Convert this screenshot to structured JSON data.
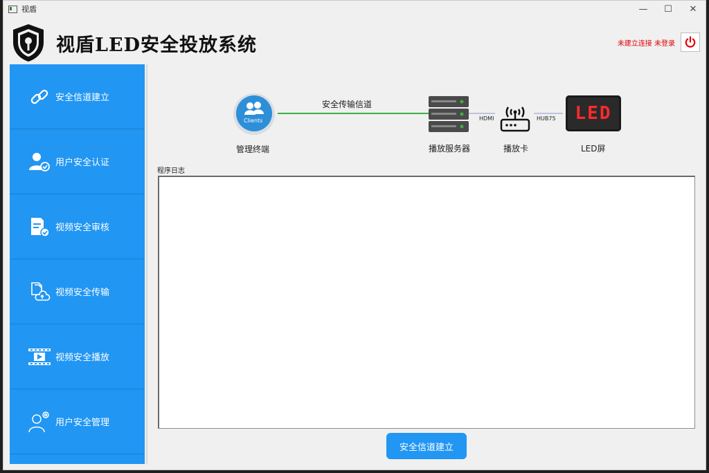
{
  "window": {
    "title": "视盾"
  },
  "header": {
    "app_title": "视盾LED安全投放系统",
    "status_text": "未建立连接 未登录"
  },
  "sidebar": {
    "items": [
      {
        "label": "安全信道建立",
        "icon": "link-icon"
      },
      {
        "label": "用户安全认证",
        "icon": "user-verified-icon"
      },
      {
        "label": "视频安全审核",
        "icon": "document-check-icon"
      },
      {
        "label": "视频安全传输",
        "icon": "file-upload-cloud-icon"
      },
      {
        "label": "视频安全播放",
        "icon": "video-play-icon"
      },
      {
        "label": "用户安全管理",
        "icon": "user-settings-icon"
      }
    ]
  },
  "diagram": {
    "client_icon_text": "Clients",
    "client_label": "管理终端",
    "channel_label": "安全传输信道",
    "server_label": "播放服务器",
    "hdmi_label": "HDMI",
    "card_label": "播放卡",
    "hub_label": "HUB75",
    "led_text": "LED",
    "led_label": "LED屏"
  },
  "log": {
    "label": "程序日志",
    "content": ""
  },
  "actions": {
    "primary_button": "安全信道建立"
  },
  "colors": {
    "accent": "#2196f3",
    "status": "#e00000",
    "channel_line": "#3cb043",
    "led_red": "#ff2a2a"
  }
}
